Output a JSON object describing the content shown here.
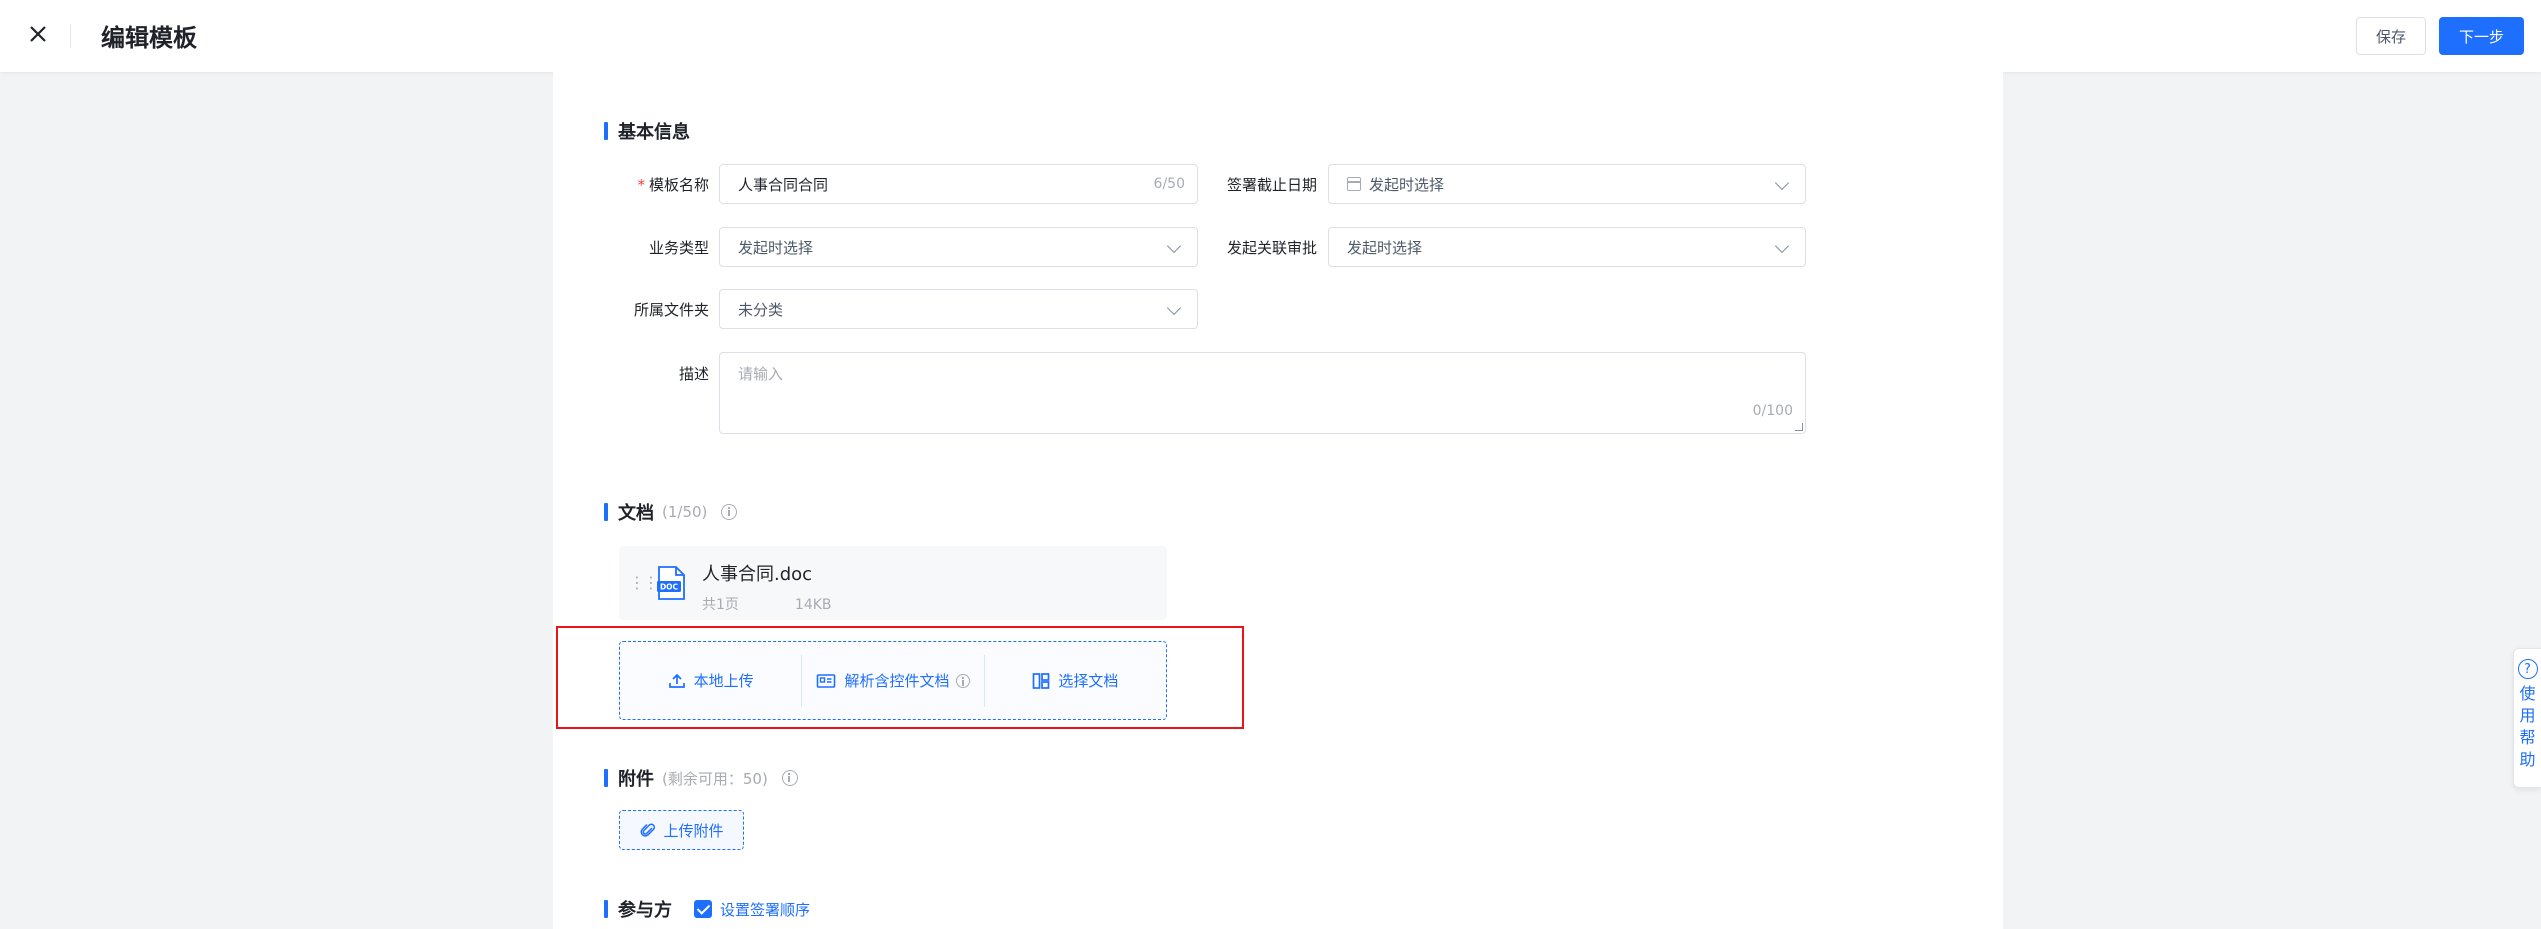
{
  "header": {
    "title": "编辑模板",
    "save_label": "保存",
    "next_label": "下一步"
  },
  "basic": {
    "section_title": "基本信息",
    "name_label": "模板名称",
    "name_value": "人事合同合同",
    "name_count": "6/50",
    "deadline_label": "签署截止日期",
    "deadline_placeholder": "发起时选择",
    "biz_type_label": "业务类型",
    "biz_type_value": "发起时选择",
    "approval_label": "发起关联审批",
    "approval_value": "发起时选择",
    "folder_label": "所属文件夹",
    "folder_value": "未分类",
    "desc_label": "描述",
    "desc_placeholder": "请输入",
    "desc_count": "0/100"
  },
  "documents": {
    "section_title": "文档",
    "count": "(1/50)",
    "file": {
      "name": "人事合同.doc",
      "pages": "共1页",
      "size": "14KB"
    },
    "upload_local": "本地上传",
    "parse_doc": "解析含控件文档",
    "choose_doc": "选择文档"
  },
  "attachments": {
    "section_title": "附件",
    "remaining": "(剩余可用：50)",
    "upload_label": "上传附件"
  },
  "participants": {
    "section_title": "参与方",
    "sign_order_label": "设置签署顺序",
    "sign_order_checked": true
  },
  "help": {
    "icon": "?",
    "text": "使用帮助"
  },
  "colors": {
    "primary": "#1f6fff",
    "highlight": "#e8161b",
    "required": "#f53f3f"
  }
}
